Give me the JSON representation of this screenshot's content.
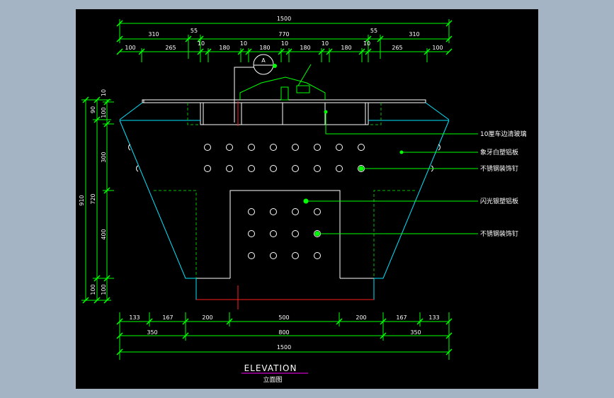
{
  "drawing": {
    "title": "ELEVATION",
    "subtitle": "立面图",
    "bubble_label": "A",
    "top_dims": {
      "total": "1500",
      "row2": [
        "310",
        "55",
        "770",
        "55",
        "310"
      ],
      "row3": [
        "100",
        "265",
        "10",
        "180",
        "10",
        "180",
        "10",
        "180",
        "10",
        "180",
        "10",
        "265",
        "100"
      ]
    },
    "bottom_dims": {
      "row1": [
        "133",
        "167",
        "200",
        "500",
        "200",
        "167",
        "133"
      ],
      "row2": [
        "350",
        "800",
        "350"
      ],
      "total": "1500"
    },
    "left_dims": {
      "outer": [
        "910"
      ],
      "middle": [
        "90",
        "720",
        "100"
      ],
      "inner": [
        "10",
        "100",
        "300",
        "400",
        "100"
      ]
    },
    "callouts": [
      "10厘车边清玻璃",
      "象牙白塑铝板",
      "不锈钢装饰钉",
      "闪光银塑铝板",
      "不锈钢装饰钉"
    ],
    "colors": {
      "dim_line": "#00ff00",
      "outline_cyan": "#00e5ff",
      "outline_white": "#ffffff",
      "dashed": "#00c000",
      "callout": "#00ff00",
      "section_red": "#ff2020",
      "underline": "#ff00ff"
    }
  }
}
